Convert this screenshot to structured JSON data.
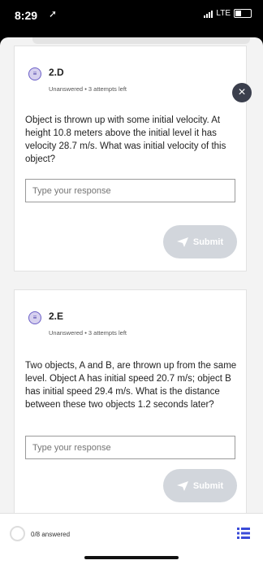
{
  "status": {
    "time": "8:29",
    "carrier": "LTE"
  },
  "questions": [
    {
      "number": "2.D",
      "meta": "Unanswered • 3 attempts left",
      "text": "Object is thrown up with some initial velocity. At height 10.8 meters above the initial level it has velocity 28.7 m/s. What was initial velocity of this object?",
      "placeholder": "Type your response",
      "submit_label": "Submit"
    },
    {
      "number": "2.E",
      "meta": "Unanswered • 3 attempts left",
      "text": "Two objects, A and B, are thrown up from the same level. Object A has initial speed 20.7 m/s; object B has initial speed 29.4 m/s. What is the distance between these two objects 1.2 seconds later?",
      "placeholder": "Type your response",
      "submit_label": "Submit"
    }
  ],
  "footer": {
    "answered": "0/8 answered"
  }
}
